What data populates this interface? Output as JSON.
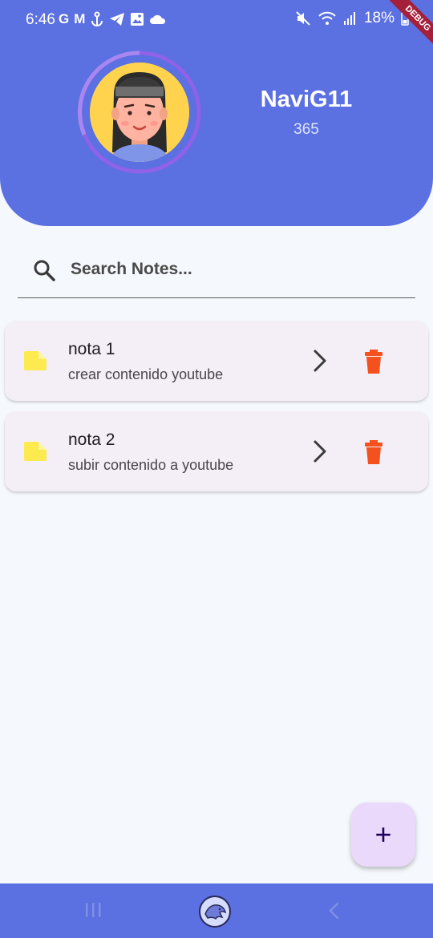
{
  "statusbar": {
    "time": "6:46",
    "left_icons": [
      "G",
      "M"
    ],
    "battery": "18%"
  },
  "debug_banner": "DEBUG",
  "profile": {
    "name": "NaviG11",
    "count": "365"
  },
  "search": {
    "placeholder": "Search Notes..."
  },
  "notes": [
    {
      "title": "nota 1",
      "subtitle": "crear contenido youtube"
    },
    {
      "title": "nota 2",
      "subtitle": "subir contenido a youtube"
    }
  ],
  "fab": {
    "label": "+"
  },
  "colors": {
    "primary": "#5b70e1",
    "card": "#f4eff6",
    "delete": "#f4511e",
    "file": "#fdea4f",
    "fab": "#ead9fb"
  }
}
